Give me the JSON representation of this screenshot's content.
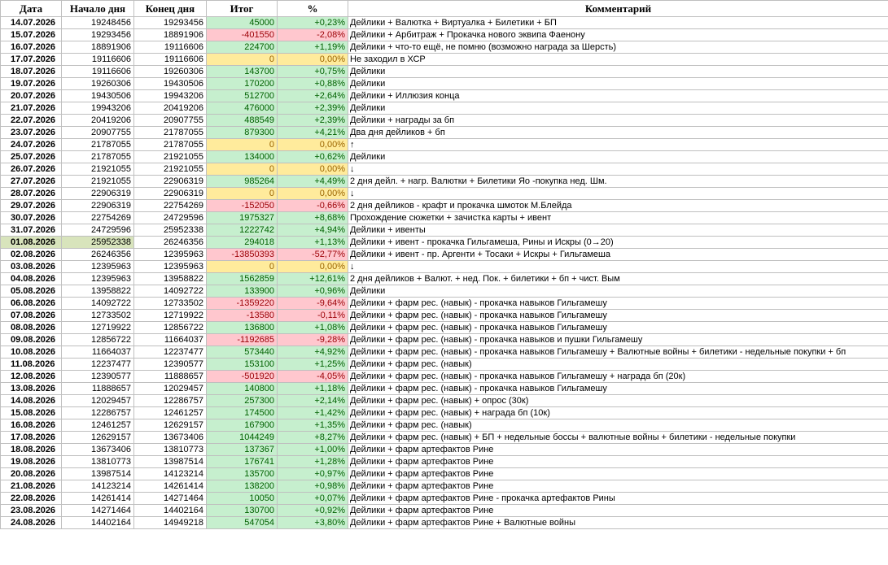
{
  "headers": [
    "Дата",
    "Начало дня",
    "Конец дня",
    "Итог",
    "%",
    "Комментарий"
  ],
  "selected_row": 18,
  "status_colors": {
    "positive_bg": "#c6efce",
    "positive_fg": "#006100",
    "negative_bg": "#ffc7ce",
    "negative_fg": "#9c0006",
    "zero_bg": "#ffeb9c",
    "zero_fg": "#9c6500"
  },
  "rows": [
    {
      "date": "14.07.2026",
      "start": "19248456",
      "end": "19293456",
      "total": "45000",
      "pct": "+0,23%",
      "status": "pos",
      "comment": "Дейлики + Валютка + Виртуалка + Билетики + БП"
    },
    {
      "date": "15.07.2026",
      "start": "19293456",
      "end": "18891906",
      "total": "-401550",
      "pct": "-2,08%",
      "status": "neg",
      "comment": "Дейлики + Арбитраж + Прокачка нового эквипа Фаенону"
    },
    {
      "date": "16.07.2026",
      "start": "18891906",
      "end": "19116606",
      "total": "224700",
      "pct": "+1,19%",
      "status": "pos",
      "comment": "Дейлики + что-то ещё, не помню (возможно награда за Шерсть)"
    },
    {
      "date": "17.07.2026",
      "start": "19116606",
      "end": "19116606",
      "total": "0",
      "pct": "0,00%",
      "status": "zero",
      "comment": "Не заходил в ХСР"
    },
    {
      "date": "18.07.2026",
      "start": "19116606",
      "end": "19260306",
      "total": "143700",
      "pct": "+0,75%",
      "status": "pos",
      "comment": "Дейлики"
    },
    {
      "date": "19.07.2026",
      "start": "19260306",
      "end": "19430506",
      "total": "170200",
      "pct": "+0,88%",
      "status": "pos",
      "comment": "Дейлики"
    },
    {
      "date": "20.07.2026",
      "start": "19430506",
      "end": "19943206",
      "total": "512700",
      "pct": "+2,64%",
      "status": "pos",
      "comment": "Дейлики + Иллюзия конца"
    },
    {
      "date": "21.07.2026",
      "start": "19943206",
      "end": "20419206",
      "total": "476000",
      "pct": "+2,39%",
      "status": "pos",
      "comment": "Дейлики"
    },
    {
      "date": "22.07.2026",
      "start": "20419206",
      "end": "20907755",
      "total": "488549",
      "pct": "+2,39%",
      "status": "pos",
      "comment": "Дейлики + награды за бп"
    },
    {
      "date": "23.07.2026",
      "start": "20907755",
      "end": "21787055",
      "total": "879300",
      "pct": "+4,21%",
      "status": "pos",
      "comment": "Два дня дейликов + бп"
    },
    {
      "date": "24.07.2026",
      "start": "21787055",
      "end": "21787055",
      "total": "0",
      "pct": "0,00%",
      "status": "zero",
      "comment": "↑"
    },
    {
      "date": "25.07.2026",
      "start": "21787055",
      "end": "21921055",
      "total": "134000",
      "pct": "+0,62%",
      "status": "pos",
      "comment": "Дейлики"
    },
    {
      "date": "26.07.2026",
      "start": "21921055",
      "end": "21921055",
      "total": "0",
      "pct": "0,00%",
      "status": "zero",
      "comment": "↓"
    },
    {
      "date": "27.07.2026",
      "start": "21921055",
      "end": "22906319",
      "total": "985264",
      "pct": "+4,49%",
      "status": "pos",
      "comment": "2 дня дейл. + нагр. Валютки + Билетики Яо -покупка нед. Шм."
    },
    {
      "date": "28.07.2026",
      "start": "22906319",
      "end": "22906319",
      "total": "0",
      "pct": "0,00%",
      "status": "zero",
      "comment": "↓"
    },
    {
      "date": "29.07.2026",
      "start": "22906319",
      "end": "22754269",
      "total": "-152050",
      "pct": "-0,66%",
      "status": "neg",
      "comment": "2 дня дейликов - крафт и прокачка шмоток М.Блейда"
    },
    {
      "date": "30.07.2026",
      "start": "22754269",
      "end": "24729596",
      "total": "1975327",
      "pct": "+8,68%",
      "status": "pos",
      "comment": "Прохождение сюжетки + зачистка карты + ивент"
    },
    {
      "date": "31.07.2026",
      "start": "24729596",
      "end": "25952338",
      "total": "1222742",
      "pct": "+4,94%",
      "status": "pos",
      "comment": "Дейлики + ивенты"
    },
    {
      "date": "01.08.2026",
      "start": "25952338",
      "end": "26246356",
      "total": "294018",
      "pct": "+1,13%",
      "status": "pos",
      "comment": "Дейлики + ивент - прокачка Гильгамеша, Рины и Искры (0→20)"
    },
    {
      "date": "02.08.2026",
      "start": "26246356",
      "end": "12395963",
      "total": "-13850393",
      "pct": "-52,77%",
      "status": "neg",
      "comment": "Дейлики + ивент - пр. Аргенти + Тосаки + Искры + Гильгамеша"
    },
    {
      "date": "03.08.2026",
      "start": "12395963",
      "end": "12395963",
      "total": "0",
      "pct": "0,00%",
      "status": "zero",
      "comment": "↓"
    },
    {
      "date": "04.08.2026",
      "start": "12395963",
      "end": "13958822",
      "total": "1562859",
      "pct": "+12,61%",
      "status": "pos",
      "comment": "2 дня дейликов + Валют. + нед. Пок. + билетики + бп + чист. Вым"
    },
    {
      "date": "05.08.2026",
      "start": "13958822",
      "end": "14092722",
      "total": "133900",
      "pct": "+0,96%",
      "status": "pos",
      "comment": "Дейлики"
    },
    {
      "date": "06.08.2026",
      "start": "14092722",
      "end": "12733502",
      "total": "-1359220",
      "pct": "-9,64%",
      "status": "neg",
      "comment": "Дейлики + фарм рес. (навык) - прокачка навыков Гильгамешу"
    },
    {
      "date": "07.08.2026",
      "start": "12733502",
      "end": "12719922",
      "total": "-13580",
      "pct": "-0,11%",
      "status": "neg",
      "comment": "Дейлики + фарм рес. (навык) - прокачка навыков Гильгамешу"
    },
    {
      "date": "08.08.2026",
      "start": "12719922",
      "end": "12856722",
      "total": "136800",
      "pct": "+1,08%",
      "status": "pos",
      "comment": "Дейлики + фарм рес. (навык) - прокачка навыков Гильгамешу"
    },
    {
      "date": "09.08.2026",
      "start": "12856722",
      "end": "11664037",
      "total": "-1192685",
      "pct": "-9,28%",
      "status": "neg",
      "comment": "Дейлики + фарм рес. (навык) - прокачка навыков и пушки Гильгамешу"
    },
    {
      "date": "10.08.2026",
      "start": "11664037",
      "end": "12237477",
      "total": "573440",
      "pct": "+4,92%",
      "status": "pos",
      "comment": "Дейлики + фарм рес. (навык) - прокачка навыков Гильгамешу + Валютные войны + билетики - недельные покупки + бп"
    },
    {
      "date": "11.08.2026",
      "start": "12237477",
      "end": "12390577",
      "total": "153100",
      "pct": "+1,25%",
      "status": "pos",
      "comment": "Дейлики + фарм рес. (навык)"
    },
    {
      "date": "12.08.2026",
      "start": "12390577",
      "end": "11888657",
      "total": "-501920",
      "pct": "-4,05%",
      "status": "neg",
      "comment": "Дейлики + фарм рес. (навык) - прокачка навыков Гильгамешу + награда бп (20к)"
    },
    {
      "date": "13.08.2026",
      "start": "11888657",
      "end": "12029457",
      "total": "140800",
      "pct": "+1,18%",
      "status": "pos",
      "comment": "Дейлики + фарм рес. (навык) - прокачка навыков Гильгамешу"
    },
    {
      "date": "14.08.2026",
      "start": "12029457",
      "end": "12286757",
      "total": "257300",
      "pct": "+2,14%",
      "status": "pos",
      "comment": "Дейлики + фарм рес. (навык) + опрос (30к)"
    },
    {
      "date": "15.08.2026",
      "start": "12286757",
      "end": "12461257",
      "total": "174500",
      "pct": "+1,42%",
      "status": "pos",
      "comment": "Дейлики + фарм рес. (навык) + награда бп (10к)"
    },
    {
      "date": "16.08.2026",
      "start": "12461257",
      "end": "12629157",
      "total": "167900",
      "pct": "+1,35%",
      "status": "pos",
      "comment": "Дейлики + фарм рес. (навык)"
    },
    {
      "date": "17.08.2026",
      "start": "12629157",
      "end": "13673406",
      "total": "1044249",
      "pct": "+8,27%",
      "status": "pos",
      "comment": "Дейлики + фарм рес. (навык) + БП + недельные боссы + валютные войны + билетики - недельные покупки"
    },
    {
      "date": "18.08.2026",
      "start": "13673406",
      "end": "13810773",
      "total": "137367",
      "pct": "+1,00%",
      "status": "pos",
      "comment": "Дейлики + фарм артефактов Рине"
    },
    {
      "date": "19.08.2026",
      "start": "13810773",
      "end": "13987514",
      "total": "176741",
      "pct": "+1,28%",
      "status": "pos",
      "comment": "Дейлики + фарм артефактов Рине"
    },
    {
      "date": "20.08.2026",
      "start": "13987514",
      "end": "14123214",
      "total": "135700",
      "pct": "+0,97%",
      "status": "pos",
      "comment": "Дейлики + фарм артефактов Рине"
    },
    {
      "date": "21.08.2026",
      "start": "14123214",
      "end": "14261414",
      "total": "138200",
      "pct": "+0,98%",
      "status": "pos",
      "comment": "Дейлики + фарм артефактов Рине"
    },
    {
      "date": "22.08.2026",
      "start": "14261414",
      "end": "14271464",
      "total": "10050",
      "pct": "+0,07%",
      "status": "pos",
      "comment": "Дейлики + фарм артефактов Рине - прокачка артефактов Рины"
    },
    {
      "date": "23.08.2026",
      "start": "14271464",
      "end": "14402164",
      "total": "130700",
      "pct": "+0,92%",
      "status": "pos",
      "comment": "Дейлики + фарм артефактов Рине"
    },
    {
      "date": "24.08.2026",
      "start": "14402164",
      "end": "14949218",
      "total": "547054",
      "pct": "+3,80%",
      "status": "pos",
      "comment": "Дейлики + фарм артефактов Рине + Валютные войны"
    }
  ]
}
